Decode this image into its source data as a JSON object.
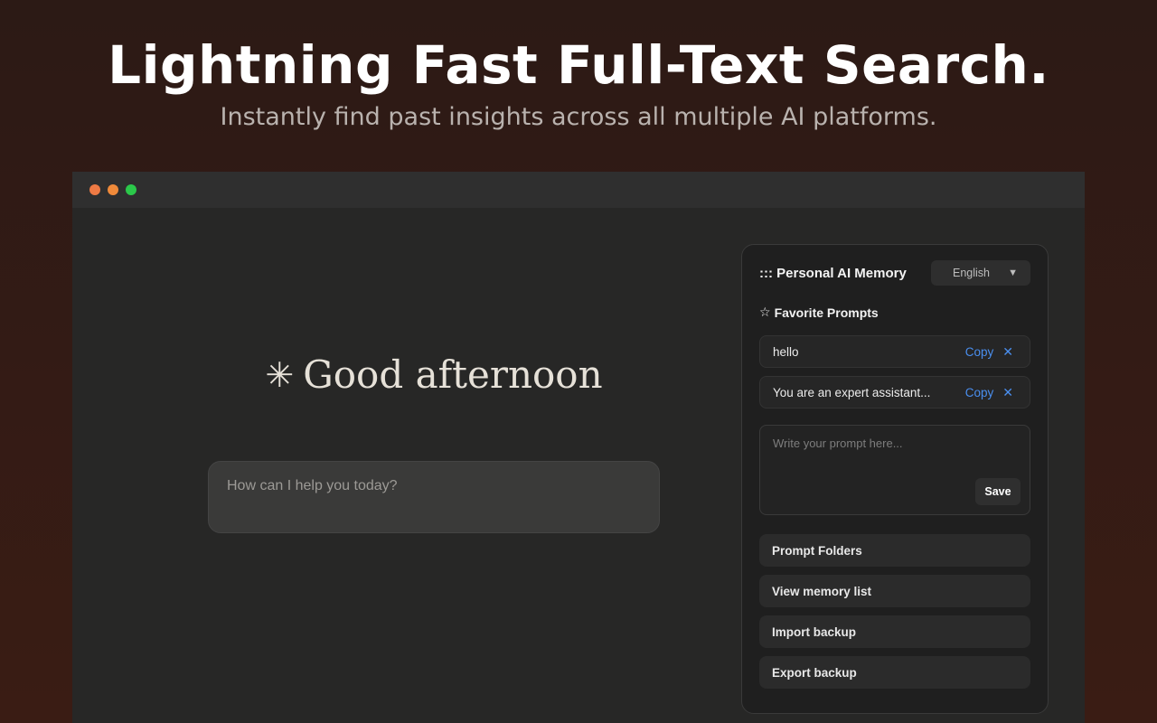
{
  "hero": {
    "title": "Lightning Fast Full-Text Search.",
    "subtitle": "Instantly find past insights across all multiple AI platforms."
  },
  "window": {
    "controls": [
      "close",
      "minimize",
      "maximize"
    ],
    "colors": {
      "close": "#ee7a44",
      "minimize": "#f08a3a",
      "maximize": "#2bc84a"
    }
  },
  "chat": {
    "greeting_icon": "✳",
    "greeting": "Good afternoon",
    "input_placeholder": "How can I help you today?"
  },
  "panel": {
    "title": "::: Personal AI Memory",
    "language": "English",
    "language_arrow": "▼",
    "favorites_icon": "☆",
    "favorites_heading": "Favorite Prompts",
    "favorites": [
      {
        "text": "hello",
        "copy_label": "Copy",
        "remove_icon": "✕"
      },
      {
        "text": "You are an expert assistant...",
        "copy_label": "Copy",
        "remove_icon": "✕"
      }
    ],
    "prompt_placeholder": "Write your prompt here...",
    "save_label": "Save",
    "menu": [
      "Prompt Folders",
      "View memory list",
      "Import backup",
      "Export backup"
    ],
    "accent_color": "#4a8ff0"
  }
}
